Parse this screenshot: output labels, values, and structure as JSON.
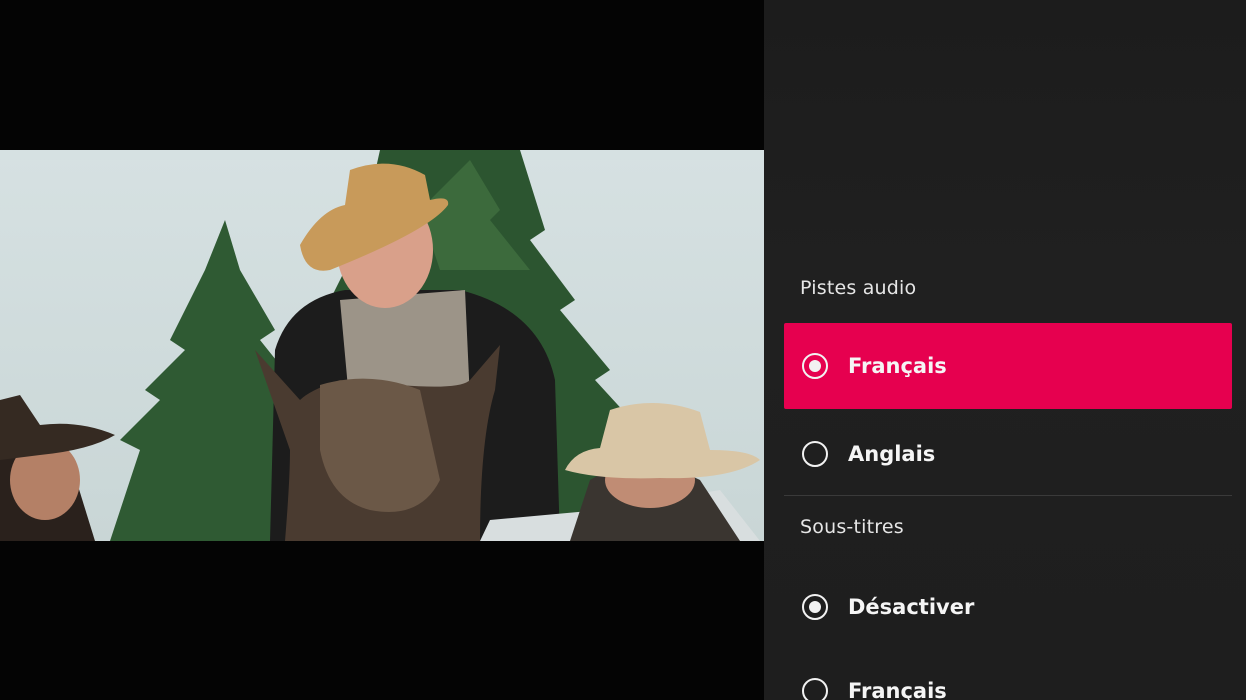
{
  "audio": {
    "title": "Pistes audio",
    "options": [
      {
        "label": "Français",
        "selected": true
      },
      {
        "label": "Anglais",
        "selected": false
      }
    ]
  },
  "subtitles": {
    "title": "Sous-titres",
    "options": [
      {
        "label": "Désactiver",
        "selected": true
      },
      {
        "label": "Français",
        "selected": false
      }
    ]
  },
  "colors": {
    "accent": "#e6004f",
    "panel_bg": "#1e1e1e",
    "text": "#f5f5f5"
  }
}
